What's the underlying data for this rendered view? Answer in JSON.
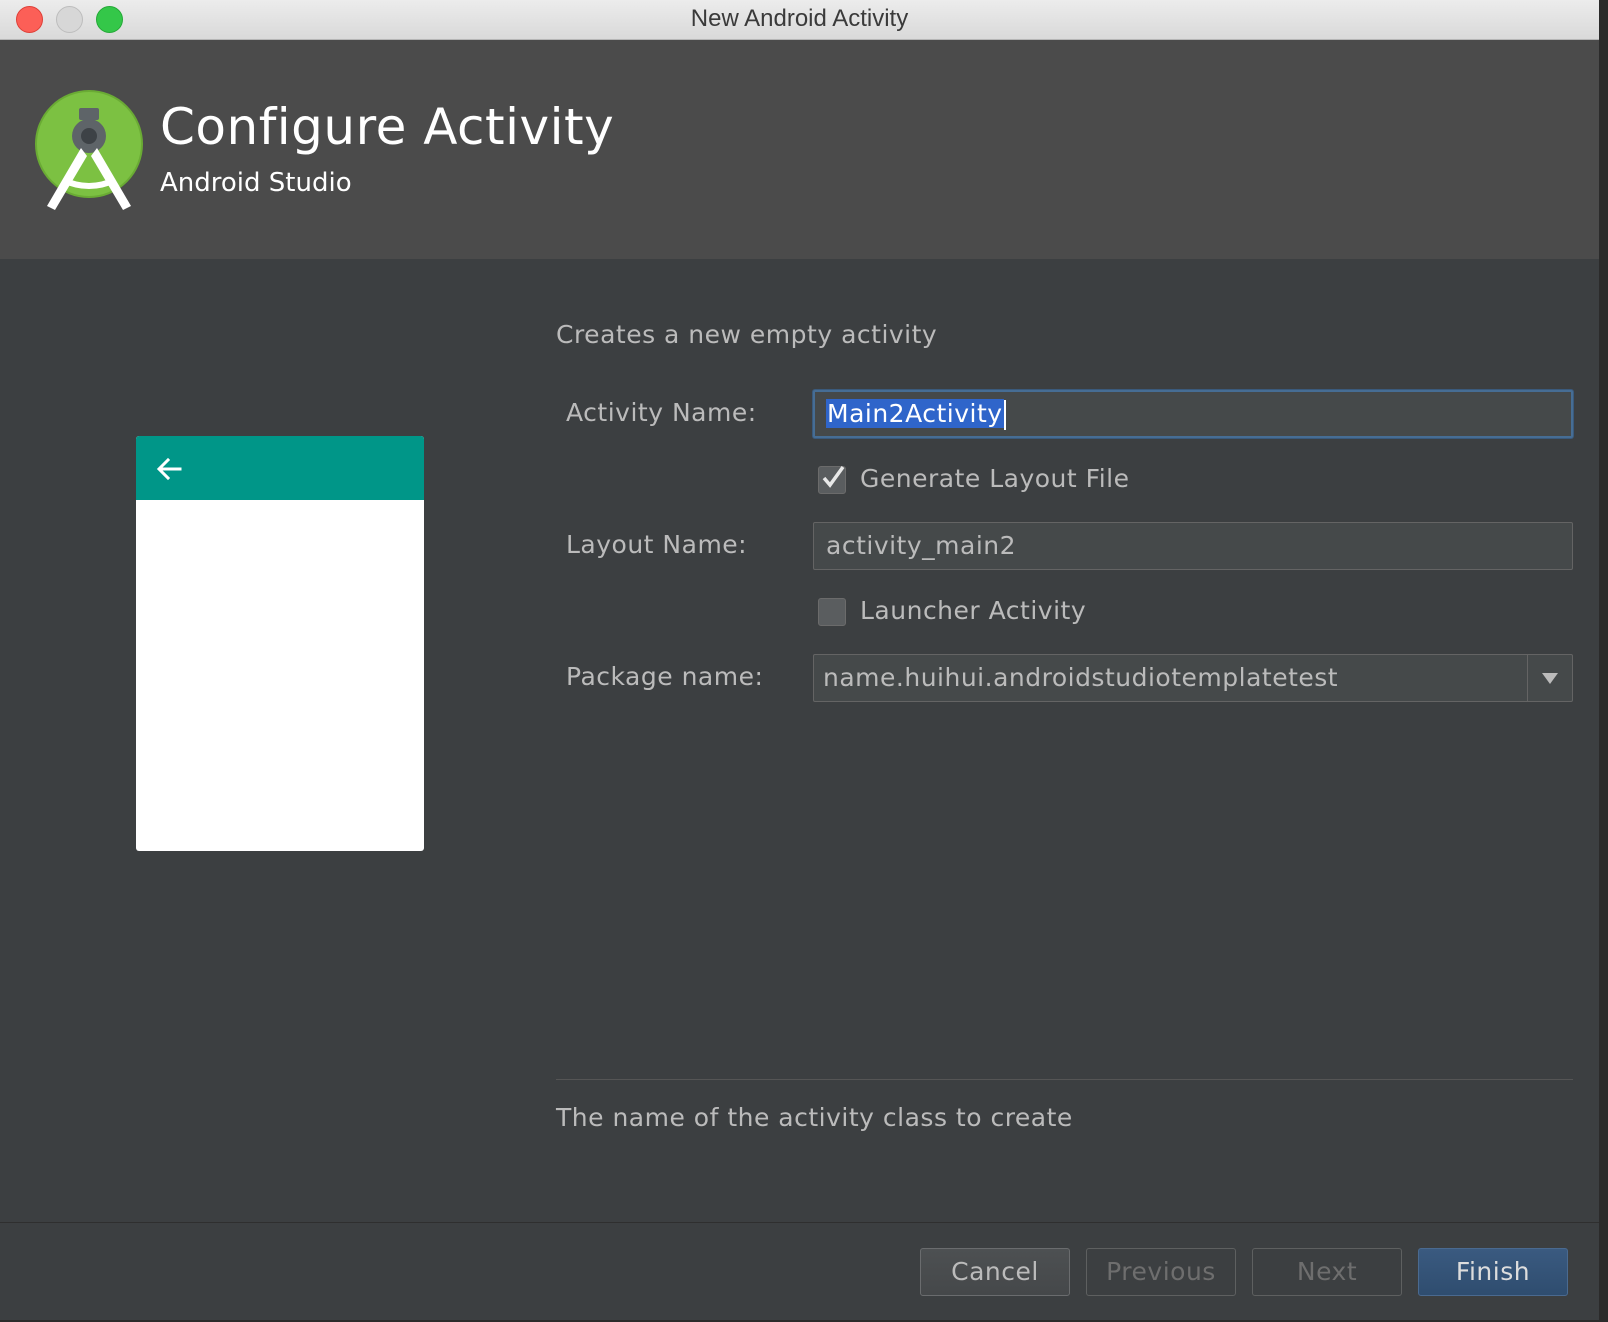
{
  "window": {
    "title": "New Android Activity"
  },
  "header": {
    "title": "Configure Activity",
    "subtitle": "Android Studio",
    "logo_icon": "android-studio-logo-icon"
  },
  "preview": {
    "toolbar_color": "#009688",
    "back_icon": "arrow-left-icon"
  },
  "form": {
    "description": "Creates a new empty activity",
    "activity_name": {
      "label": "Activity Name:",
      "value": "Main2Activity"
    },
    "generate_layout": {
      "label": "Generate Layout File",
      "checked": true
    },
    "layout_name": {
      "label": "Layout Name:",
      "value": "activity_main2"
    },
    "launcher_activity": {
      "label": "Launcher Activity",
      "checked": false
    },
    "package_name": {
      "label": "Package name:",
      "value": "name.huihui.androidstudiotemplatetest"
    }
  },
  "help_text": "The name of the activity class to create",
  "buttons": {
    "cancel": "Cancel",
    "previous": "Previous",
    "next": "Next",
    "finish": "Finish"
  },
  "colors": {
    "background": "#3c3f41",
    "header": "#4b4b4b",
    "accent": "#2f65ca",
    "text": "#bbbbbb"
  }
}
